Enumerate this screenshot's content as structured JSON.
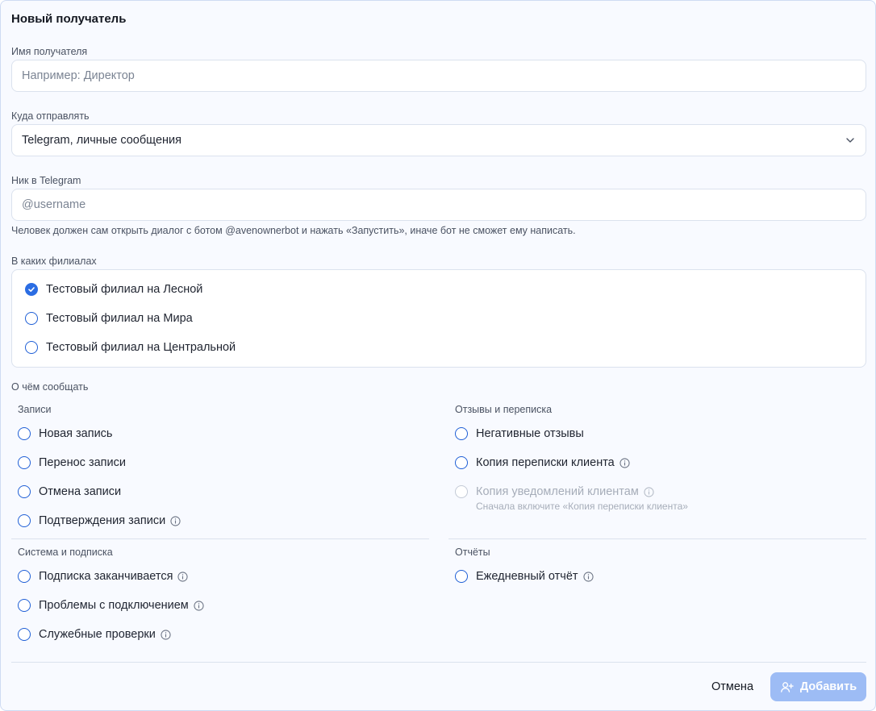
{
  "dialog": {
    "title": "Новый получатель",
    "name": {
      "label": "Имя получателя",
      "value": "",
      "placeholder": "Например: Директор"
    },
    "destination": {
      "label": "Куда отправлять",
      "selected": "Telegram, личные сообщения"
    },
    "telegram": {
      "label": "Ник в Telegram",
      "value": "",
      "placeholder": "@username",
      "hint": "Человек должен сам открыть диалог с ботом @avenownerbot и нажать «Запустить», иначе бот не сможет ему написать."
    },
    "branches": {
      "label": "В каких филиалах",
      "items": [
        {
          "label": "Тестовый филиал на Лесной",
          "checked": true
        },
        {
          "label": "Тестовый филиал на Мира",
          "checked": false
        },
        {
          "label": "Тестовый филиал на Центральной",
          "checked": false
        }
      ]
    },
    "notify": {
      "label": "О чём сообщать",
      "bookings": {
        "title": "Записи",
        "items": [
          "Новая запись",
          "Перенос записи",
          "Отмена записи",
          "Подтверждения записи"
        ]
      },
      "reviews": {
        "title": "Отзывы и переписка",
        "items": [
          "Негативные отзывы",
          "Копия переписки клиента",
          "Копия уведомлений клиентам"
        ],
        "disabled_hint": "Сначала включите «Копия переписки клиента»"
      },
      "system": {
        "title": "Система и подписка",
        "items": [
          "Подписка заканчивается",
          "Проблемы с подключением",
          "Служебные проверки"
        ]
      },
      "reports": {
        "title": "Отчёты",
        "items": [
          "Ежедневный отчёт"
        ]
      }
    },
    "actions": {
      "cancel": "Отмена",
      "add": "Добавить"
    },
    "colors": {
      "accent": "#2b6de3",
      "add_button": "#9dbcf5",
      "border": "#dbe2ee"
    }
  }
}
